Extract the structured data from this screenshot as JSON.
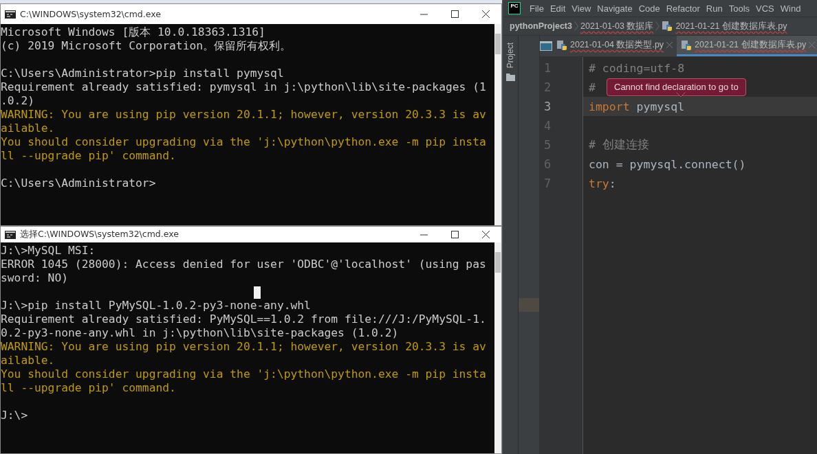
{
  "terminals": [
    {
      "title": "C:\\WINDOWS\\system32\\cmd.exe",
      "lines": [
        {
          "kind": "output",
          "text": "Microsoft Windows [版本 10.0.18363.1316]"
        },
        {
          "kind": "output",
          "text": "(c) 2019 Microsoft Corporation。保留所有权利。"
        },
        {
          "kind": "output"
        },
        {
          "kind": "output",
          "text": "C:\\Users\\Administrator>pip install pymysql"
        },
        {
          "kind": "output",
          "text": "Requirement already satisfied: pymysql in j:\\python\\lib\\site-packages (1"
        },
        {
          "kind": "output",
          "text": ".0.2)"
        },
        {
          "kind": "warning",
          "text": "WARNING: You are using pip version 20.1.1; however, version 20.3.3 is av"
        },
        {
          "kind": "warning",
          "text": "ailable."
        },
        {
          "kind": "warning",
          "text": "You should consider upgrading via the 'j:\\python\\python.exe -m pip insta"
        },
        {
          "kind": "warning",
          "text": "ll --upgrade pip' command."
        },
        {
          "kind": "output"
        },
        {
          "kind": "output",
          "text": "C:\\Users\\Administrator>"
        }
      ]
    },
    {
      "title": "选择C:\\WINDOWS\\system32\\cmd.exe",
      "lines": [
        {
          "kind": "output",
          "text": "J:\\>MySQL MSI:"
        },
        {
          "kind": "output",
          "text": "ERROR 1045 (28000): Access denied for user 'ODBC'@'localhost' (using pas"
        },
        {
          "kind": "output",
          "text": "sword: NO)"
        },
        {
          "kind": "cursor"
        },
        {
          "kind": "output",
          "text": "J:\\>pip install PyMySQL-1.0.2-py3-none-any.whl"
        },
        {
          "kind": "output",
          "text": "Requirement already satisfied: PyMySQL==1.0.2 from file:///J:/PyMySQL-1."
        },
        {
          "kind": "output",
          "text": "0.2-py3-none-any.whl in j:\\python\\lib\\site-packages (1.0.2)"
        },
        {
          "kind": "warning",
          "text": "WARNING: You are using pip version 20.1.1; however, version 20.3.3 is av"
        },
        {
          "kind": "warning",
          "text": "ailable."
        },
        {
          "kind": "warning",
          "text": "You should consider upgrading via the 'j:\\python\\python.exe -m pip insta"
        },
        {
          "kind": "warning",
          "text": "ll --upgrade pip' command."
        },
        {
          "kind": "output"
        },
        {
          "kind": "output",
          "text": "J:\\>"
        }
      ]
    }
  ],
  "ide": {
    "logo": "PC",
    "menu": [
      "File",
      "Edit",
      "View",
      "Navigate",
      "Code",
      "Refactor",
      "Run",
      "Tools",
      "VCS",
      "Wind"
    ],
    "breadcrumb": [
      {
        "label": "pythonProject3",
        "kind": "project"
      },
      {
        "label": "2021-01-03 数据库",
        "kind": "folder"
      },
      {
        "label": "2021-01-21 创建数据库表.py",
        "kind": "file"
      }
    ],
    "side_tool": "Project",
    "tabs": [
      {
        "label": "2021-01-04 数据类型.py",
        "selected": false
      },
      {
        "label": "2021-01-21 创建数据库表.py",
        "selected": true
      }
    ],
    "code": [
      {
        "number": "1",
        "current": false,
        "tokens": [
          {
            "kind": "comment",
            "text": "# coding=utf-8"
          }
        ]
      },
      {
        "number": "2",
        "current": false,
        "tokens": [
          {
            "kind": "comment",
            "text": "#"
          }
        ]
      },
      {
        "number": "3",
        "current": true,
        "tokens": [
          {
            "kind": "keyword",
            "text": "import"
          },
          {
            "kind": "plain",
            "text": " pymysql"
          }
        ]
      },
      {
        "number": "4",
        "current": false
      },
      {
        "number": "5",
        "current": false,
        "tokens": [
          {
            "kind": "comment",
            "text": "# 创建连接"
          }
        ]
      },
      {
        "number": "6",
        "current": false,
        "tokens": [
          {
            "kind": "plain",
            "text": "con = pymysql.connect()"
          }
        ]
      },
      {
        "number": "7",
        "current": false,
        "tokens": [
          {
            "kind": "keyword",
            "text": "try"
          },
          {
            "kind": "plain",
            "text": ":"
          }
        ]
      }
    ],
    "tooltip": "Cannot find declaration to go to"
  }
}
